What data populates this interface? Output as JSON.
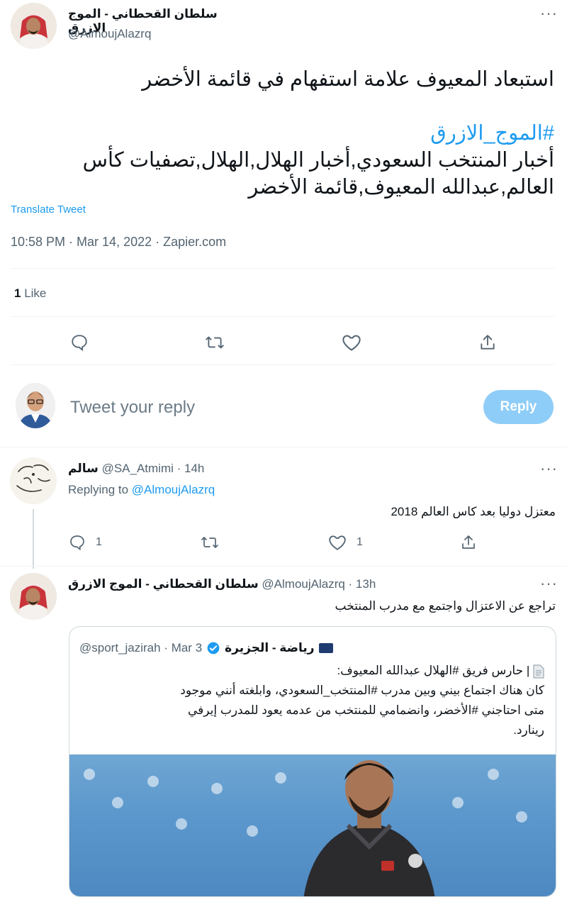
{
  "main_tweet": {
    "display_name": "سلطان القحطاني - الموج الازرق",
    "handle": "@AlmoujAlazrq",
    "text_line1": "استبعاد المعيوف علامة استفهام في قائمة الأخضر",
    "hashtag": "#الموج_الازرق",
    "tags_line1": "أخبار المنتخب السعودي,أخبار الهلال,الهلال,تصفيات كأس",
    "tags_line2": "العالم,عبدالله المعيوف,قائمة الأخضر",
    "translate": "Translate Tweet",
    "meta": "10:58 PM · Mar 14, 2022 · Zapier.com",
    "likes_count": "1",
    "likes_label": "Like"
  },
  "composer": {
    "placeholder": "Tweet your reply",
    "reply_button": "Reply"
  },
  "reply1": {
    "display_name": "سالم",
    "handle_time": "@SA_Atmimi · 14h",
    "replying_prefix": "Replying to",
    "replying_handle": "@AlmoujAlazrq",
    "text": "معتزل دوليا بعد كاس العالم 2018",
    "reply_count": "1",
    "like_count": "1"
  },
  "reply2": {
    "display_name": "سلطان القحطاني - الموج الازرق",
    "handle_time": "@AlmoujAlazrq · 13h",
    "text": "تراجع عن الاعتزال واجتمع مع مدرب المنتخب"
  },
  "quote": {
    "display_name": "رياضة - الجزيرة",
    "handle_time": "@sport_jazirah · Mar 3",
    "line1": "| حارس فريق #الهلال عبدالله المعيوف:",
    "line2": "كان هناك اجتماع بيني وبين مدرب #المنتخب_السعودي، وابلغته أنني موجود",
    "line3": "متى احتاجني #الأخضر، وانضمامي للمنتخب من عدمه يعود للمدرب إيرفي",
    "line4": "رينارد."
  },
  "colors": {
    "accent": "#1d9bf0",
    "text": "#0f1419",
    "muted": "#536471",
    "reply_button": "#8ecdf8"
  },
  "icons": [
    "more-icon",
    "reply-icon",
    "retweet-icon",
    "like-icon",
    "share-icon",
    "verified-icon",
    "document-icon"
  ]
}
